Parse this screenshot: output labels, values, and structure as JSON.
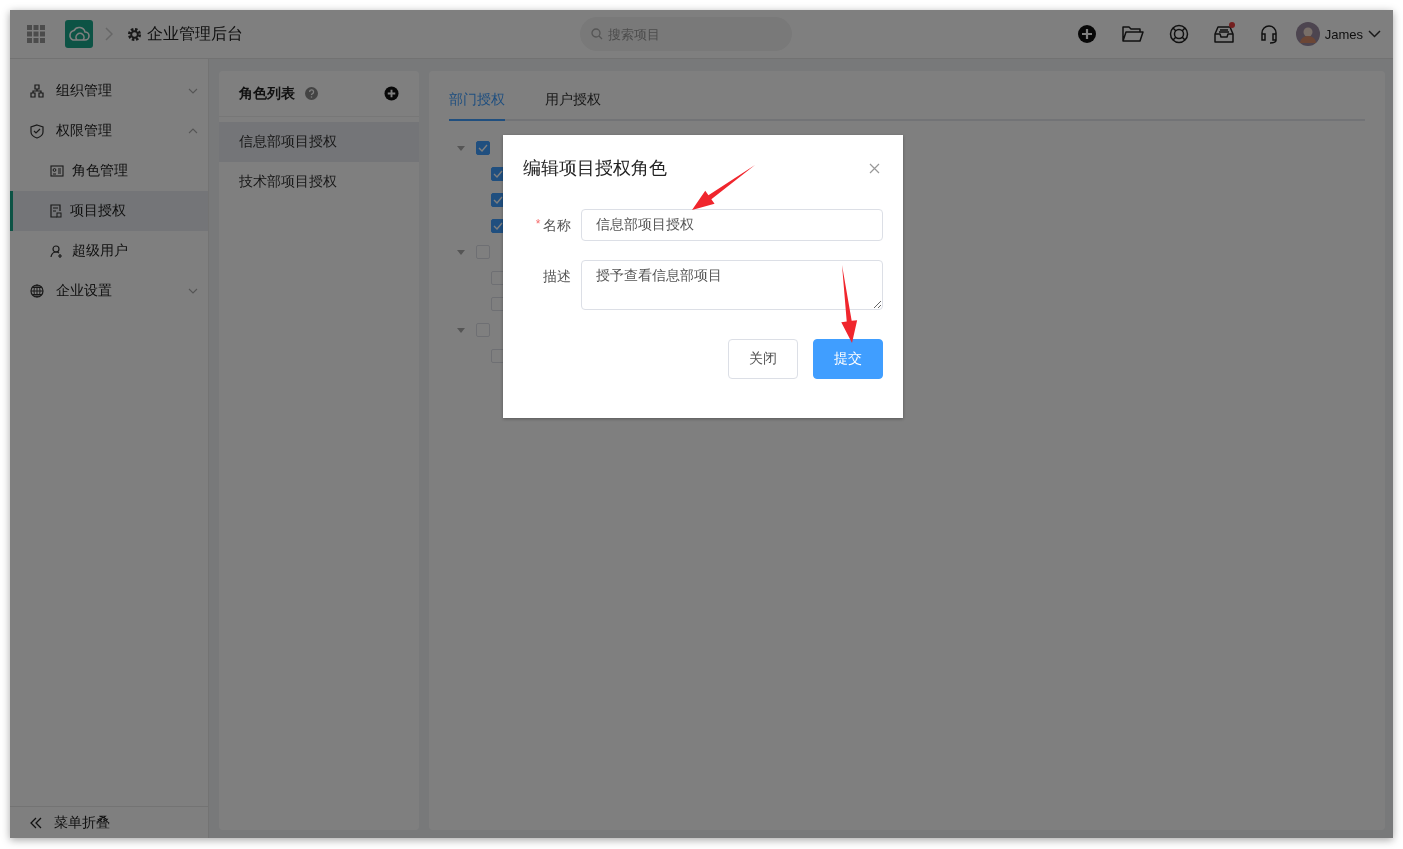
{
  "header": {
    "title": "企业管理后台",
    "search_placeholder": "搜索项目",
    "inbox_unread": true,
    "user_name": "James"
  },
  "sidebar": {
    "items": [
      {
        "label": "组织管理",
        "expanded": false,
        "selected": false
      },
      {
        "label": "权限管理",
        "expanded": true,
        "selected": false,
        "children": [
          {
            "label": "角色管理",
            "selected": false
          },
          {
            "label": "项目授权",
            "selected": true
          },
          {
            "label": "超级用户",
            "selected": false
          }
        ]
      },
      {
        "label": "企业设置",
        "expanded": false,
        "selected": false
      }
    ],
    "collapse_label": "菜单折叠"
  },
  "roles": {
    "title": "角色列表",
    "items": [
      {
        "label": "信息部项目授权",
        "selected": true
      },
      {
        "label": "技术部项目授权",
        "selected": false
      }
    ]
  },
  "tabs": [
    {
      "label": "部门授权",
      "selected": true
    },
    {
      "label": "用户授权",
      "selected": false
    }
  ],
  "tree": [
    {
      "checked": true,
      "expanded": true,
      "children": [
        {
          "checked": true
        },
        {
          "checked": true
        },
        {
          "checked": true
        }
      ]
    },
    {
      "checked": false,
      "expanded": true,
      "children": [
        {
          "checked": false
        },
        {
          "checked": false
        }
      ]
    },
    {
      "checked": false,
      "expanded": true,
      "children": [
        {
          "checked": false
        }
      ]
    }
  ],
  "dialog": {
    "title": "编辑项目授权角色",
    "fields": [
      {
        "kind": "input",
        "required_mark": "*",
        "label": "名称",
        "value": "信息部项目授权"
      },
      {
        "kind": "textarea",
        "label": "描述",
        "value": "授予查看信息部项目"
      }
    ],
    "buttons": [
      {
        "kind": "default",
        "label": "关闭"
      },
      {
        "kind": "primary",
        "label": "提交"
      }
    ]
  },
  "annotations": [
    {
      "kind": "arrow"
    },
    {
      "kind": "arrow"
    }
  ]
}
